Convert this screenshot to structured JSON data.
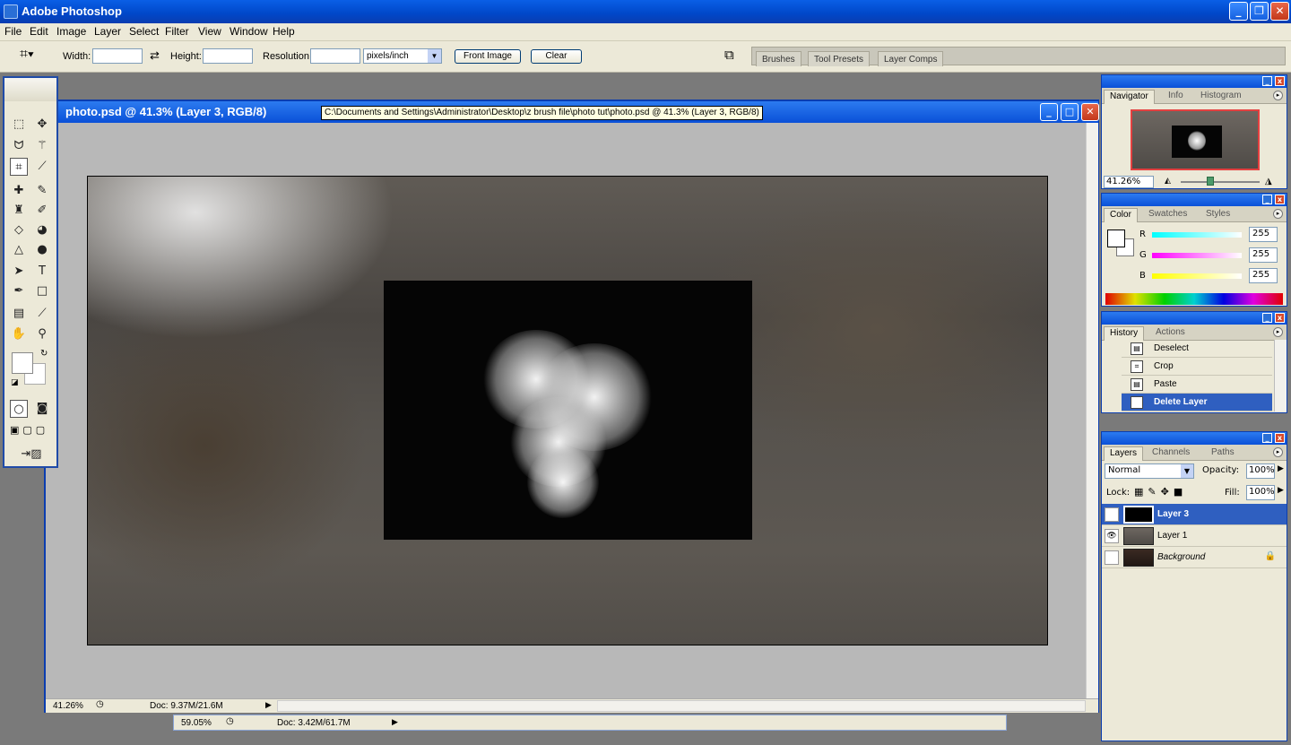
{
  "app": {
    "title": "Adobe Photoshop"
  },
  "menu": [
    "File",
    "Edit",
    "Image",
    "Layer",
    "Select",
    "Filter",
    "View",
    "Window",
    "Help"
  ],
  "options": {
    "width_label": "Width:",
    "height_label": "Height:",
    "resolution_label": "Resolution:",
    "units_value": "pixels/inch",
    "front_image_label": "Front Image",
    "clear_label": "Clear",
    "well_tabs": [
      "Brushes",
      "Tool Presets",
      "Layer Comps"
    ]
  },
  "document": {
    "title": "photo.psd @ 41.3% (Layer 3, RGB/8)",
    "tooltip": "C:\\Documents and Settings\\Administrator\\Desktop\\z brush file\\photo tut\\photo.psd @ 41.3% (Layer 3, RGB/8)",
    "zoom": "41.26%",
    "doc_size": "Doc: 9.37M/21.6M"
  },
  "document2": {
    "zoom": "59.05%",
    "doc_size": "Doc: 3.42M/61.7M"
  },
  "navigator": {
    "tabs": [
      "Navigator",
      "Info",
      "Histogram"
    ],
    "zoom": "41.26%"
  },
  "color": {
    "tabs": [
      "Color",
      "Swatches",
      "Styles"
    ],
    "channels": [
      {
        "label": "R",
        "value": "255"
      },
      {
        "label": "G",
        "value": "255"
      },
      {
        "label": "B",
        "value": "255"
      }
    ]
  },
  "history": {
    "tabs": [
      "History",
      "Actions"
    ],
    "items": [
      "Deselect",
      "Crop",
      "Paste",
      "Delete Layer"
    ],
    "selected": "Delete Layer"
  },
  "layers": {
    "tabs": [
      "Layers",
      "Channels",
      "Paths"
    ],
    "blend_mode": "Normal",
    "opacity_label": "Opacity:",
    "opacity": "100%",
    "lock_label": "Lock:",
    "fill_label": "Fill:",
    "fill": "100%",
    "items": [
      "Layer 3",
      "Layer 1",
      "Background"
    ],
    "selected": "Layer 3"
  }
}
